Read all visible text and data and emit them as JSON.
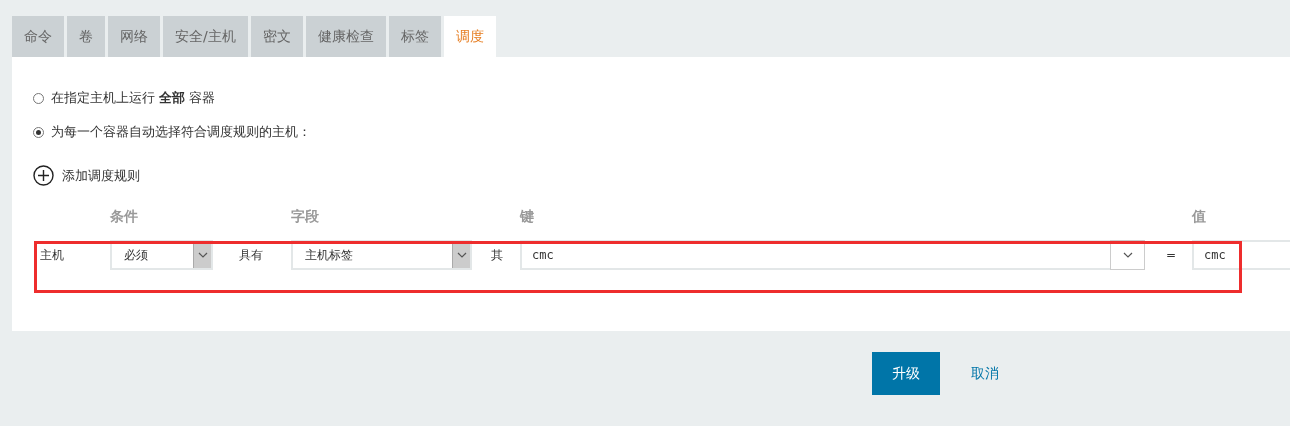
{
  "tabs": [
    {
      "label": "命令",
      "selected": false
    },
    {
      "label": "卷",
      "selected": false
    },
    {
      "label": "网络",
      "selected": false
    },
    {
      "label": "安全/主机",
      "selected": false
    },
    {
      "label": "密文",
      "selected": false
    },
    {
      "label": "健康检查",
      "selected": false
    },
    {
      "label": "标签",
      "selected": false
    },
    {
      "label": "调度",
      "selected": true
    }
  ],
  "scheduling_options": [
    {
      "label": "在指定主机上运行 **全部** 容器",
      "selected": false
    },
    {
      "label": "为每一个容器自动选择符合调度规则的主机：",
      "selected": true
    }
  ],
  "add_rule": {
    "label": "添加调度规则"
  },
  "rules": {
    "columns": [
      "条件",
      "字段",
      "键",
      "值"
    ],
    "rows": [
      {
        "subject": "主机",
        "condition": "必须",
        "has_label": "具有",
        "field": "主机标签",
        "its_label": "其",
        "key": "cmc",
        "equals": "=",
        "value": "cmc",
        "highlighted": true
      }
    ]
  },
  "buttons": [
    {
      "label": "升级",
      "kind": "primary"
    },
    {
      "label": "取消",
      "kind": "link"
    }
  ]
}
